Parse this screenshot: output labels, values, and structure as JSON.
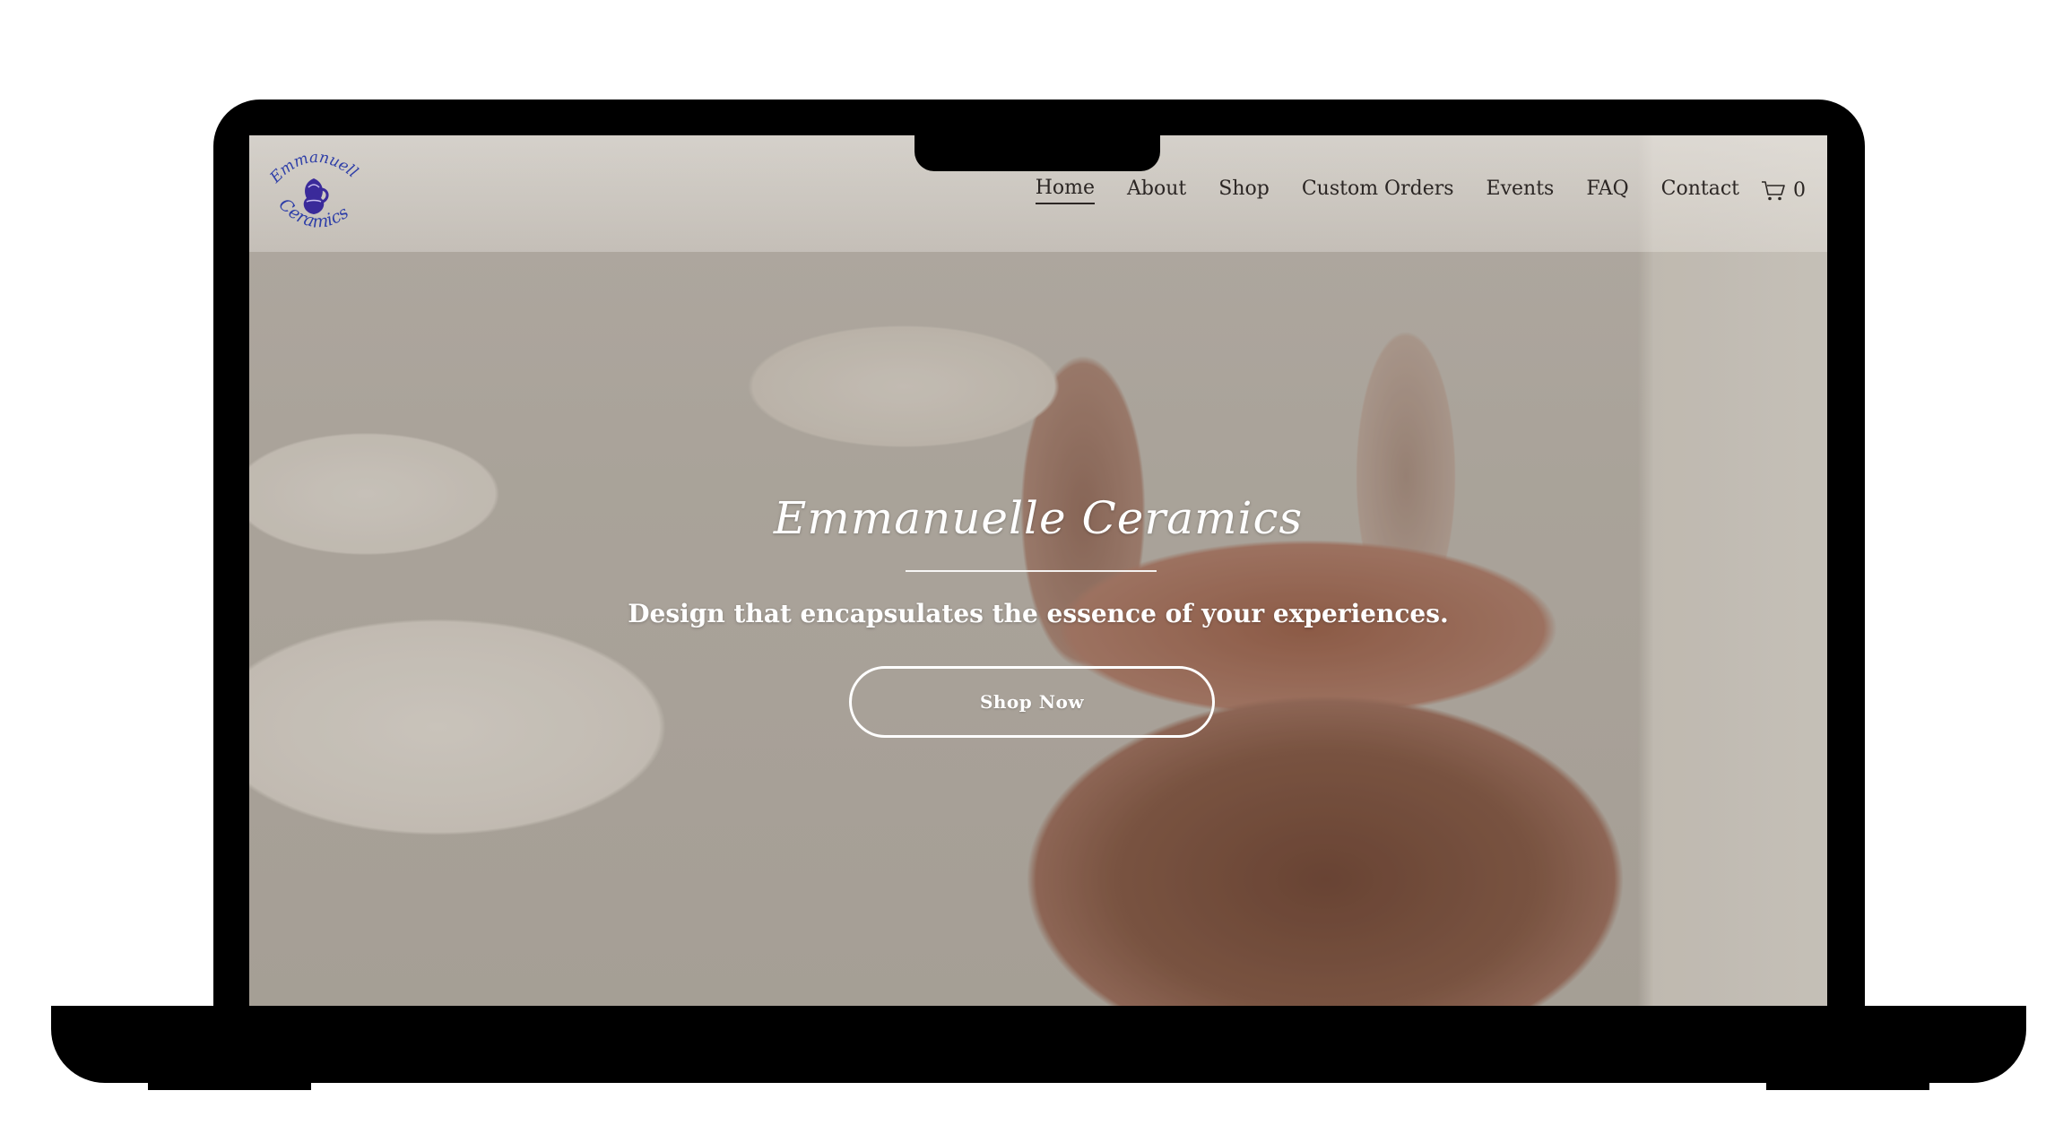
{
  "brand": {
    "logo_line1": "Emmanuelle",
    "logo_line2": "Ceramics",
    "logo_color": "#2f3fa8"
  },
  "nav": {
    "items": [
      {
        "label": "Home",
        "active": true
      },
      {
        "label": "About"
      },
      {
        "label": "Shop"
      },
      {
        "label": "Custom Orders"
      },
      {
        "label": "Events"
      },
      {
        "label": "FAQ"
      },
      {
        "label": "Contact"
      }
    ],
    "cart_icon": "shopping-cart-icon",
    "cart_count": "0"
  },
  "hero": {
    "title": "Emmanuelle Ceramics",
    "tagline": "Design that encapsulates the essence of your experiences.",
    "cta_label": "Shop Now"
  },
  "colors": {
    "text_dark": "#2b2624",
    "hero_text": "#ffffff",
    "device_frame": "#000000"
  }
}
